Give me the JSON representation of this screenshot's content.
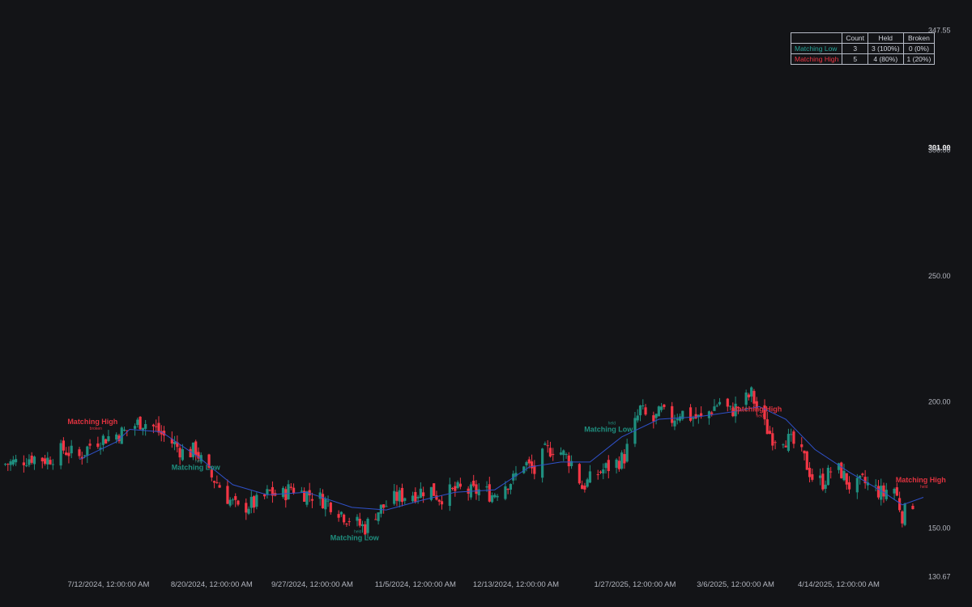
{
  "theme": {
    "background": "#131417",
    "up_color": "#26a69a",
    "up_body": "#1f8f7f",
    "down_color": "#f23645",
    "ma_color": "#2f51c9",
    "text_color": "#b2b5be",
    "low_label_color": "#1f8f7f",
    "high_label_color": "#e0323f"
  },
  "stats_table": {
    "headers": [
      "",
      "Count",
      "Held",
      "Broken"
    ],
    "rows": [
      {
        "name": "Matching Low",
        "count": "3",
        "held": "3 (100%)",
        "broken": "0 (0%)",
        "color": "#26a69a"
      },
      {
        "name": "Matching High",
        "count": "5",
        "held": "4 (80%)",
        "broken": "1 (20%)",
        "color": "#f23645"
      }
    ]
  },
  "chart_data": {
    "type": "candlestick",
    "title": "",
    "y_axis_labels": [
      "347.55",
      "301.00",
      "300.00",
      "250.00",
      "200.00",
      "150.00",
      "130.67"
    ],
    "ylim": [
      130.67,
      347.55
    ],
    "x_axis_labels": [
      {
        "label": "7/12/2024, 12:00:00 AM",
        "date": "2024-07-12"
      },
      {
        "label": "8/20/2024, 12:00:00 AM",
        "date": "2024-08-20"
      },
      {
        "label": "9/27/2024, 12:00:00 AM",
        "date": "2024-09-27"
      },
      {
        "label": "11/5/2024, 12:00:00 AM",
        "date": "2024-11-05"
      },
      {
        "label": "12/13/2024, 12:00:00 AM",
        "date": "2024-12-13"
      },
      {
        "label": "1/27/2025, 12:00:00 AM",
        "date": "2025-01-27"
      },
      {
        "label": "3/6/2025, 12:00:00 AM",
        "date": "2025-03-06"
      },
      {
        "label": "4/14/2025, 12:00:00 AM",
        "date": "2025-04-14"
      }
    ],
    "xlim": [
      "2024-06-01",
      "2025-05-16"
    ],
    "series_close": [
      [
        "2024-06-01",
        175
      ],
      [
        "2024-06-07",
        176
      ],
      [
        "2024-06-13",
        178
      ],
      [
        "2024-06-19",
        177
      ],
      [
        "2024-06-25",
        181
      ],
      [
        "2024-07-01",
        178
      ],
      [
        "2024-07-06",
        184
      ],
      [
        "2024-07-12",
        186
      ],
      [
        "2024-07-18",
        188
      ],
      [
        "2024-07-24",
        192
      ],
      [
        "2024-07-28",
        191
      ],
      [
        "2024-08-01",
        187
      ],
      [
        "2024-08-06",
        183
      ],
      [
        "2024-08-10",
        179
      ],
      [
        "2024-08-14",
        181
      ],
      [
        "2024-08-18",
        172
      ],
      [
        "2024-08-22",
        168
      ],
      [
        "2024-08-26",
        162
      ],
      [
        "2024-08-30",
        157
      ],
      [
        "2024-09-03",
        159
      ],
      [
        "2024-09-07",
        160
      ],
      [
        "2024-09-11",
        164
      ],
      [
        "2024-09-15",
        162
      ],
      [
        "2024-09-19",
        166
      ],
      [
        "2024-09-23",
        164
      ],
      [
        "2024-09-27",
        163
      ],
      [
        "2024-10-01",
        161
      ],
      [
        "2024-10-05",
        159
      ],
      [
        "2024-10-09",
        155
      ],
      [
        "2024-10-13",
        152
      ],
      [
        "2024-10-17",
        150
      ],
      [
        "2024-10-21",
        156
      ],
      [
        "2024-10-25",
        159
      ],
      [
        "2024-10-29",
        162
      ],
      [
        "2024-11-02",
        163
      ],
      [
        "2024-11-06",
        164
      ],
      [
        "2024-11-10",
        166
      ],
      [
        "2024-11-14",
        162
      ],
      [
        "2024-11-18",
        164
      ],
      [
        "2024-11-22",
        165
      ],
      [
        "2024-11-26",
        164
      ],
      [
        "2024-11-30",
        165
      ],
      [
        "2024-12-04",
        163
      ],
      [
        "2024-12-08",
        167
      ],
      [
        "2024-12-12",
        169
      ],
      [
        "2024-12-16",
        176
      ],
      [
        "2024-12-20",
        172
      ],
      [
        "2024-12-24",
        180
      ],
      [
        "2024-12-28",
        182
      ],
      [
        "2024-12-31",
        179
      ],
      [
        "2025-01-04",
        175
      ],
      [
        "2025-01-07",
        166
      ],
      [
        "2025-01-11",
        170
      ],
      [
        "2025-01-15",
        173
      ],
      [
        "2025-01-19",
        175
      ],
      [
        "2025-01-23",
        178
      ],
      [
        "2025-01-26",
        188
      ],
      [
        "2025-01-29",
        197
      ],
      [
        "2025-02-02",
        191
      ],
      [
        "2025-02-06",
        196
      ],
      [
        "2025-02-09",
        192
      ],
      [
        "2025-02-13",
        196
      ],
      [
        "2025-02-17",
        194
      ],
      [
        "2025-02-21",
        193
      ],
      [
        "2025-02-25",
        197
      ],
      [
        "2025-02-28",
        200
      ],
      [
        "2025-03-04",
        196
      ],
      [
        "2025-03-08",
        199
      ],
      [
        "2025-03-12",
        203
      ],
      [
        "2025-03-16",
        192
      ],
      [
        "2025-03-20",
        186
      ],
      [
        "2025-03-24",
        186
      ],
      [
        "2025-03-28",
        183
      ],
      [
        "2025-04-01",
        177
      ],
      [
        "2025-04-04",
        170
      ],
      [
        "2025-04-08",
        168
      ],
      [
        "2025-04-12",
        174
      ],
      [
        "2025-04-15",
        172
      ],
      [
        "2025-04-19",
        165
      ],
      [
        "2025-04-23",
        168
      ],
      [
        "2025-04-27",
        166
      ],
      [
        "2025-05-01",
        163
      ],
      [
        "2025-05-04",
        169
      ],
      [
        "2025-05-08",
        155
      ],
      [
        "2025-05-12",
        160
      ]
    ],
    "moving_average": [
      [
        "2024-07-01",
        177
      ],
      [
        "2024-07-15",
        184
      ],
      [
        "2024-07-20",
        189
      ],
      [
        "2024-08-01",
        188
      ],
      [
        "2024-08-15",
        178
      ],
      [
        "2024-08-28",
        167
      ],
      [
        "2024-09-10",
        163
      ],
      [
        "2024-09-25",
        164
      ],
      [
        "2024-10-12",
        158
      ],
      [
        "2024-10-25",
        157
      ],
      [
        "2024-11-08",
        161
      ],
      [
        "2024-11-20",
        164
      ],
      [
        "2024-12-05",
        165
      ],
      [
        "2024-12-18",
        174
      ],
      [
        "2024-12-30",
        176
      ],
      [
        "2025-01-10",
        176
      ],
      [
        "2025-01-22",
        186
      ],
      [
        "2025-02-05",
        193
      ],
      [
        "2025-02-20",
        194
      ],
      [
        "2025-03-05",
        196
      ],
      [
        "2025-03-15",
        198
      ],
      [
        "2025-03-25",
        193
      ],
      [
        "2025-04-05",
        181
      ],
      [
        "2025-04-18",
        172
      ],
      [
        "2025-05-01",
        164
      ],
      [
        "2025-05-08",
        159
      ],
      [
        "2025-05-16",
        162
      ]
    ],
    "annotations": [
      {
        "text": "Matching High",
        "type": "high",
        "date": "2024-07-06",
        "value": 191,
        "status": "broken"
      },
      {
        "text": "Matching Low",
        "type": "low",
        "date": "2024-08-14",
        "value": 173,
        "status": "held"
      },
      {
        "text": "Matching Low",
        "type": "low",
        "date": "2024-10-13",
        "value": 145,
        "status": "held"
      },
      {
        "text": "Matching Low",
        "type": "low",
        "date": "2025-01-17",
        "value": 188,
        "status": "held"
      },
      {
        "text": "Matching High",
        "type": "high",
        "date": "2025-03-14",
        "value": 196,
        "status": "held"
      },
      {
        "text": "Matching High",
        "type": "high",
        "date": "2025-05-15",
        "value": 168,
        "status": "held"
      }
    ]
  }
}
